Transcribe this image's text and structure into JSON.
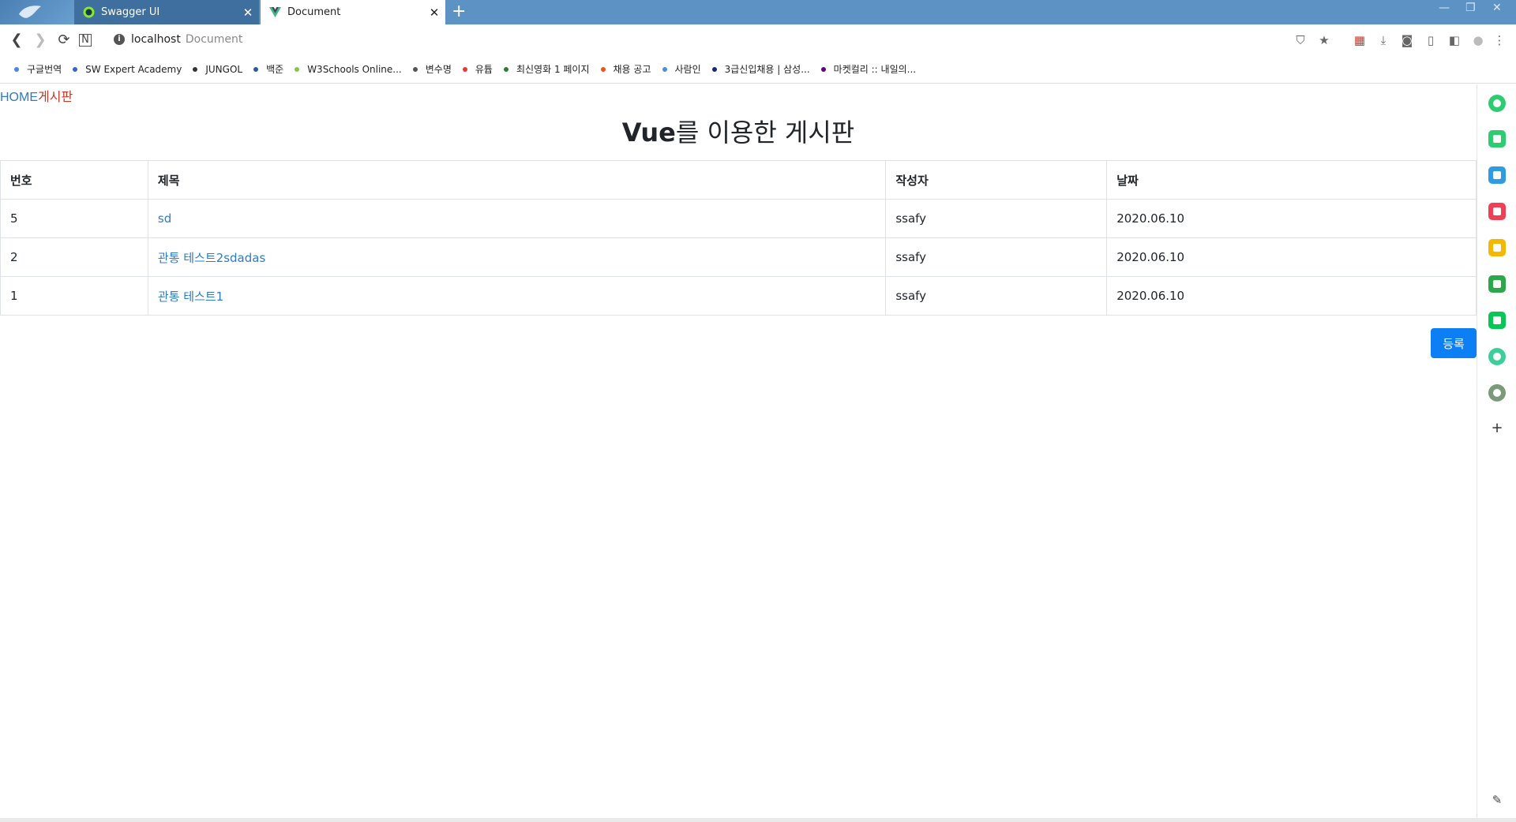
{
  "browser": {
    "tabs": [
      {
        "title": "Swagger UI",
        "icon": "swagger-icon",
        "active": false
      },
      {
        "title": "Document",
        "icon": "vue-icon",
        "active": true
      }
    ],
    "address": {
      "host": "localhost",
      "page_title": "Document"
    },
    "bookmarks": [
      {
        "label": "구글번역",
        "color": "#4a86e8"
      },
      {
        "label": "SW Expert Academy",
        "color": "#3366cc"
      },
      {
        "label": "JUNGOL",
        "color": "#333333"
      },
      {
        "label": "백준",
        "color": "#2c5aa0"
      },
      {
        "label": "W3Schools Online...",
        "color": "#8bc34a"
      },
      {
        "label": "변수명",
        "color": "#555555"
      },
      {
        "label": "유튭",
        "color": "#e53935"
      },
      {
        "label": "최신영화 1 페이지",
        "color": "#2e7d32"
      },
      {
        "label": "채용 공고",
        "color": "#f4511e"
      },
      {
        "label": "사람인",
        "color": "#4a90d9"
      },
      {
        "label": "3급신입채용 | 삼성...",
        "color": "#1a237e"
      },
      {
        "label": "마켓컬리 :: 내일의...",
        "color": "#5f0080"
      }
    ]
  },
  "breadcrumb": {
    "home": "HOME",
    "board": "게시판"
  },
  "page_title": {
    "bold": "Vue",
    "rest": "를 이용한 게시판"
  },
  "table": {
    "headers": [
      "번호",
      "제목",
      "작성자",
      "날짜"
    ],
    "rows": [
      {
        "no": "5",
        "title": "sd",
        "author": "ssafy",
        "date": "2020.06.10"
      },
      {
        "no": "2",
        "title": "관통 테스트2sdadas",
        "author": "ssafy",
        "date": "2020.06.10"
      },
      {
        "no": "1",
        "title": "관통 테스트1",
        "author": "ssafy",
        "date": "2020.06.10"
      }
    ]
  },
  "register_button": "등록",
  "sidebar_icons": [
    {
      "name": "whale-green-icon",
      "color": "#2ecc71"
    },
    {
      "name": "notes-icon",
      "color": "#2ecc71"
    },
    {
      "name": "calendar-icon",
      "color": "#2f9be0"
    },
    {
      "name": "pocket-icon",
      "color": "#ef4056"
    },
    {
      "name": "star-icon",
      "color": "#f5b800"
    },
    {
      "name": "translate-icon",
      "color": "#2ba84a"
    },
    {
      "name": "line-icon",
      "color": "#06c755"
    },
    {
      "name": "play-icon",
      "color": "#3ccf9b"
    },
    {
      "name": "character-icon",
      "color": "#7a9a7a"
    }
  ]
}
